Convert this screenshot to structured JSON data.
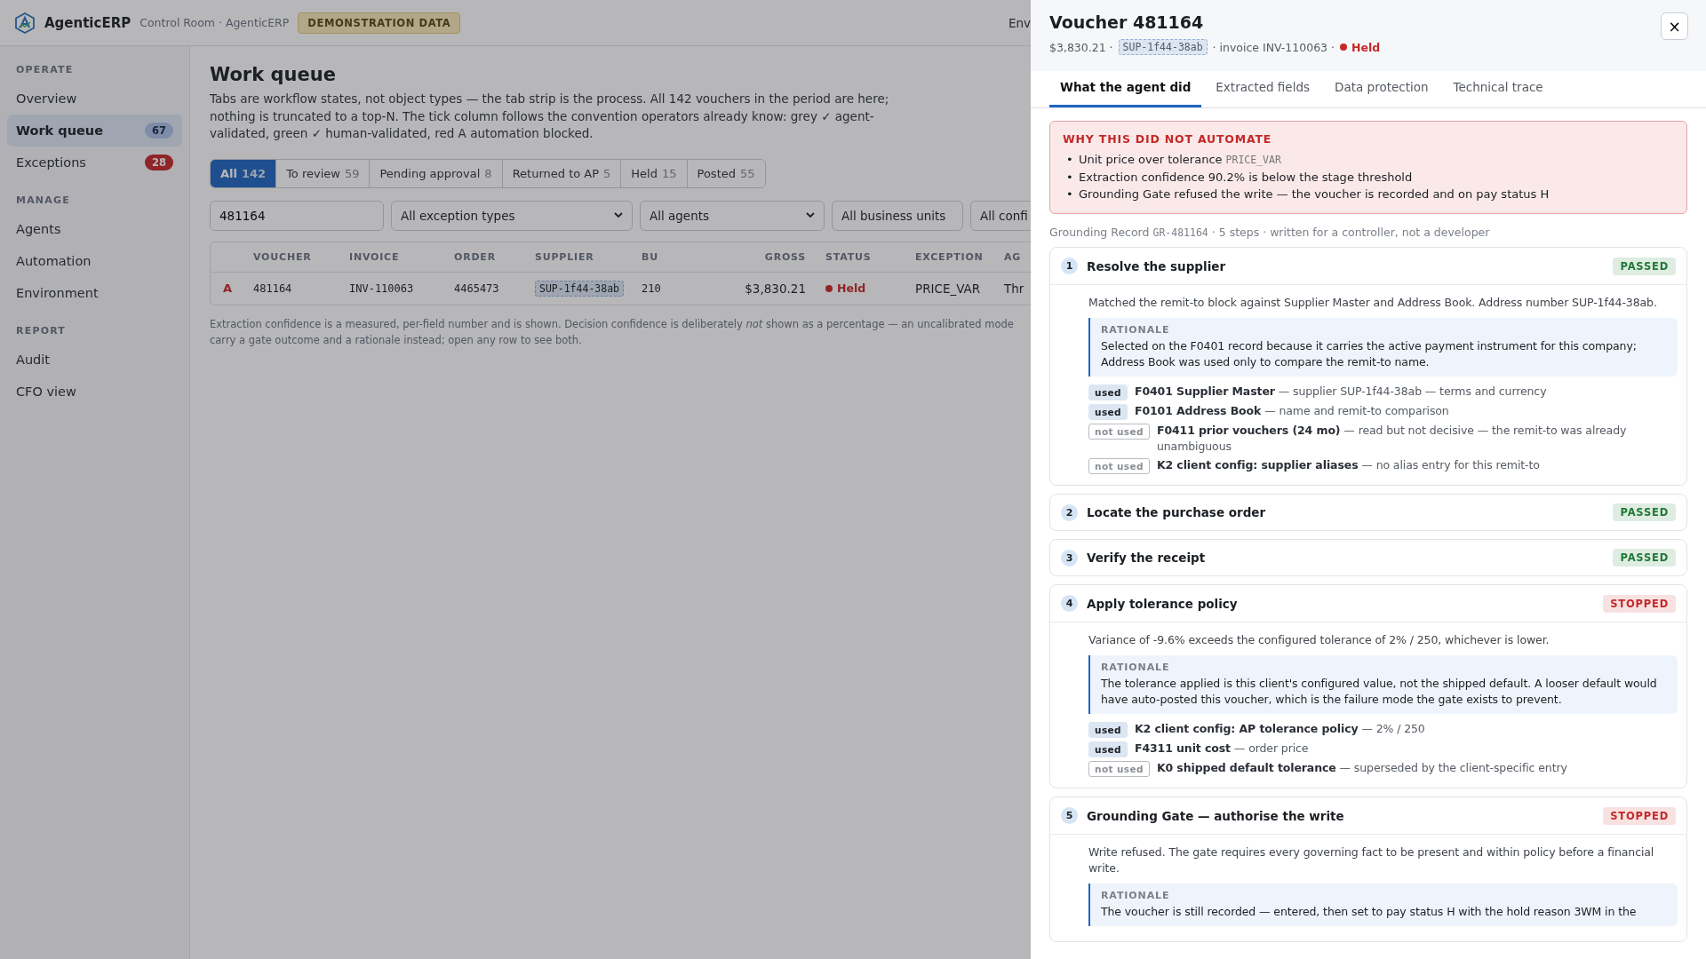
{
  "app": {
    "name": "AgenticERP",
    "breadcrumb": "Control Room · AgenticERP",
    "badge": "DEMONSTRATION DATA",
    "header_right": "Env"
  },
  "sidebar": {
    "sections": [
      {
        "title": "OPERATE",
        "items": [
          {
            "label": "Overview",
            "selected": false
          },
          {
            "label": "Work queue",
            "selected": true,
            "badge": {
              "count": "67",
              "color": "#7d8ea7"
            }
          },
          {
            "label": "Exceptions",
            "selected": false,
            "badge": {
              "count": "28",
              "color": "#902527"
            }
          }
        ]
      },
      {
        "title": "MANAGE",
        "items": [
          {
            "label": "Agents",
            "selected": false
          },
          {
            "label": "Automation",
            "selected": false
          },
          {
            "label": "Environment",
            "selected": false
          }
        ]
      },
      {
        "title": "REPORT",
        "items": [
          {
            "label": "Audit",
            "selected": false
          },
          {
            "label": "CFO view",
            "selected": false
          }
        ]
      }
    ]
  },
  "page": {
    "title": "Work queue",
    "description": "Tabs are workflow states, not object types — the tab strip is the process. All 142 vouchers in the period are here; nothing is truncated to a top-N. The tick column follows the convention operators already know: grey ✓ agent-validated, green ✓ human-validated, red A automation blocked.",
    "tabs": [
      {
        "label": "All",
        "count": "142",
        "selected": true
      },
      {
        "label": "To review",
        "count": "59",
        "selected": false
      },
      {
        "label": "Pending approval",
        "count": "8",
        "selected": false
      },
      {
        "label": "Returned to AP",
        "count": "5",
        "selected": false
      },
      {
        "label": "Held",
        "count": "15",
        "selected": false
      },
      {
        "label": "Posted",
        "count": "55",
        "selected": false
      }
    ],
    "search": {
      "value": "481164"
    },
    "filters": [
      "All exception types",
      "All agents",
      "All business units",
      "All confi"
    ],
    "table": {
      "columns": [
        "VOUCHER",
        "INVOICE",
        "ORDER",
        "SUPPLIER",
        "BU",
        "GROSS",
        "STATUS",
        "EXCEPTION",
        "AG"
      ],
      "rows": [
        {
          "flag": "A",
          "voucher": "481164",
          "invoice": "INV-110063",
          "order": "4465473",
          "supplier": "SUP-1f44-38ab",
          "bu": "210",
          "gross": "$3,830.21",
          "status": {
            "label": "Held",
            "color": "#902527"
          },
          "exception": "PRICE_VAR",
          "column_10": "Thr"
        }
      ]
    },
    "footnote": [
      "Extraction confidence is a measured, per-field number and is shown. Decision confidence is deliberately *not* shown as a percentage — an uncalibrated mode",
      "carry a gate outcome and a rationale instead; open any row to see both."
    ]
  },
  "drawer": {
    "title": "Voucher 481164",
    "amount": "$3,830.21 ·",
    "supplier": "SUP-1f44-38ab",
    "invoice": "· invoice INV-110063 ·",
    "status": {
      "label": "Held",
      "color": "#c62828"
    },
    "close": "×",
    "tabs": [
      {
        "label": "What the agent did",
        "selected": true
      },
      {
        "label": "Extracted fields",
        "selected": false
      },
      {
        "label": "Data protection",
        "selected": false
      },
      {
        "label": "Technical trace",
        "selected": false
      }
    ],
    "alert": {
      "title": "WHY THIS DID NOT AUTOMATE",
      "bullet": "•",
      "items": [
        {
          "text": "Unit price over tolerance",
          "code": "PRICE_VAR"
        },
        {
          "text": "Extraction confidence 90.2% is below the stage threshold"
        },
        {
          "text": "Grounding Gate refused the write — the voucher is recorded and on pay status H"
        }
      ]
    },
    "record": {
      "prefix": "Grounding Record",
      "code": "GR-481164",
      "suffix": "· 5 steps · written for a controller, not a developer"
    },
    "steps": [
      {
        "number": "1",
        "title": "Resolve the supplier",
        "status": {
          "label": "PASSED",
          "color": "#1e7a35"
        },
        "expanded": true,
        "summary": "Matched the remit-to block against Supplier Master and Address Book. Address number SUP-1f44-38ab.",
        "rationale_label": "RATIONALE",
        "rationale": "Selected on the F0401 record because it carries the active payment instrument for this company; Address Book was used only to compare the remit-to name.",
        "sources": [
          {
            "tag": "used",
            "used": true,
            "text": "**F0401 Supplier Master** — supplier SUP-1f44-38ab — terms and currency"
          },
          {
            "tag": "used",
            "used": true,
            "text": "**F0101 Address Book** — name and remit-to comparison"
          },
          {
            "tag": "not used",
            "used": false,
            "text": "**F0411 prior vouchers (24 mo)** — read but not decisive — the remit-to was already unambiguous"
          },
          {
            "tag": "not used",
            "used": false,
            "text": "**K2 client config: supplier aliases** — no alias entry for this remit-to"
          }
        ]
      },
      {
        "number": "2",
        "title": "Locate the purchase order",
        "status": {
          "label": "PASSED",
          "color": "#1e7a35"
        },
        "expanded": false
      },
      {
        "number": "3",
        "title": "Verify the receipt",
        "status": {
          "label": "PASSED",
          "color": "#1e7a35"
        },
        "expanded": false
      },
      {
        "number": "4",
        "title": "Apply tolerance policy",
        "status": {
          "label": "STOPPED",
          "color": "#c62828"
        },
        "expanded": true,
        "summary": "Variance of -9.6% exceeds the configured tolerance of 2% / 250, whichever is lower.",
        "rationale_label": "RATIONALE",
        "rationale": "The tolerance applied is this client's configured value, not the shipped default. A looser default would have auto-posted this voucher, which is the failure mode the gate exists to prevent.",
        "sources": [
          {
            "tag": "used",
            "used": true,
            "text": "**K2 client config: AP tolerance policy** — 2% / 250"
          },
          {
            "tag": "used",
            "used": true,
            "text": "**F4311 unit cost** — order price"
          },
          {
            "tag": "not used",
            "used": false,
            "text": "**K0 shipped default tolerance** — superseded by the client-specific entry"
          }
        ]
      },
      {
        "number": "5",
        "title": "Grounding Gate — authorise the write",
        "status": {
          "label": "STOPPED",
          "color": "#c62828"
        },
        "expanded": true,
        "summary": "Write refused. The gate requires every governing fact to be present and within policy before a financial write.",
        "rationale_label": "RATIONALE",
        "rationale": "The voucher is still recorded — entered, then set to pay status H with the hold reason 3WM in the"
      }
    ]
  }
}
